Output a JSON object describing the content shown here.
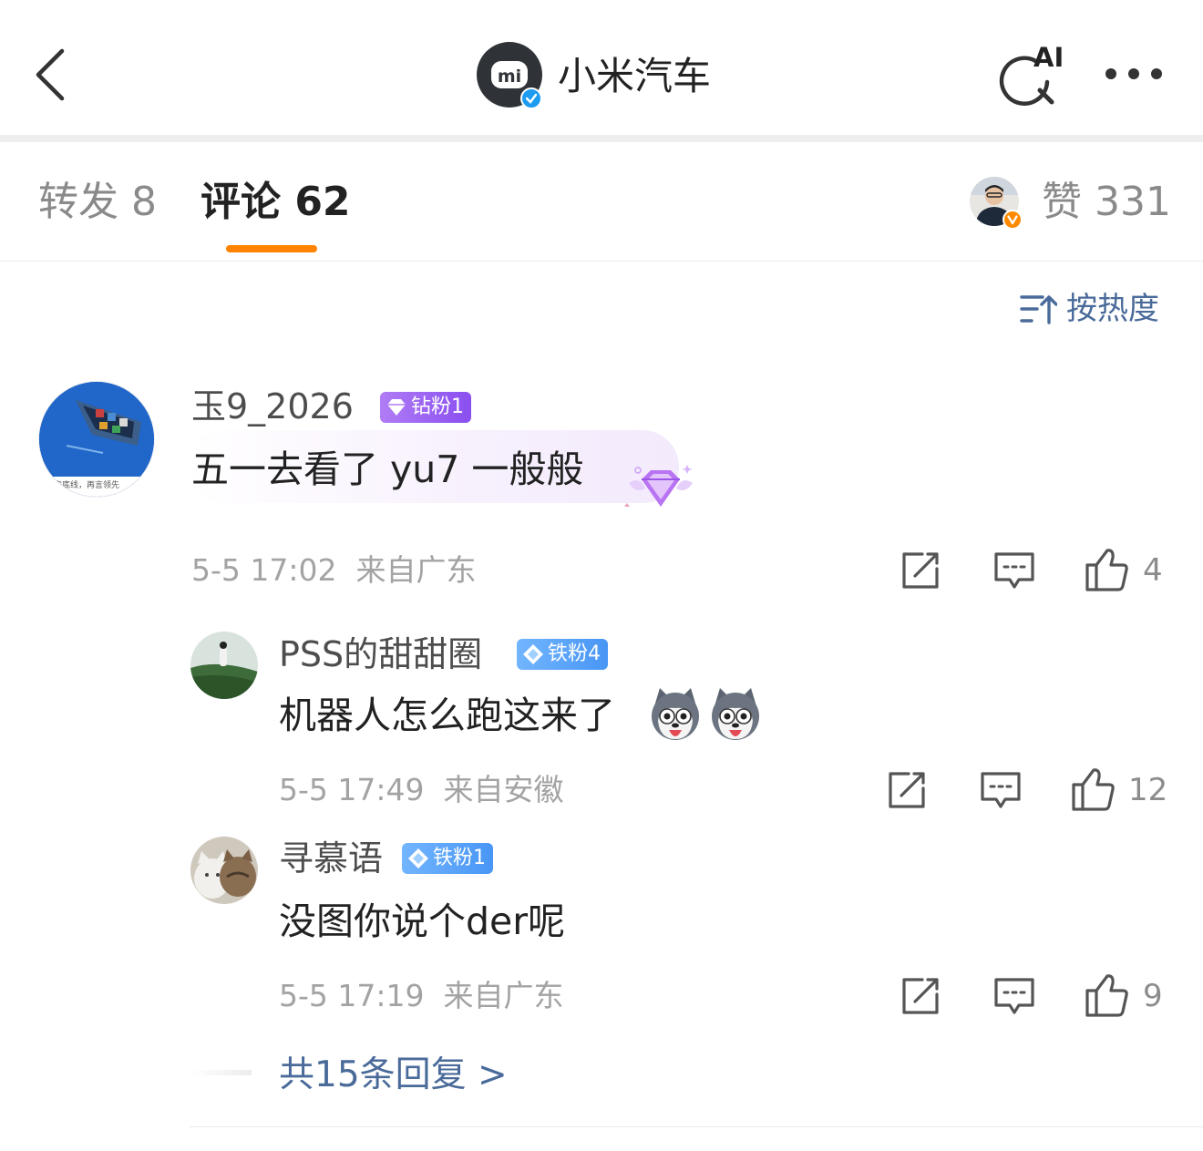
{
  "header": {
    "title": "小米汽车",
    "logo_text": "mi",
    "ai_label": "AI",
    "icons": [
      "back-arrow-icon",
      "verified-badge-icon",
      "ai-search-icon",
      "more-icon"
    ]
  },
  "tabs": [
    {
      "label": "转发 8",
      "active": false
    },
    {
      "label": "评论 62",
      "active": true
    },
    {
      "label": "赞 331",
      "active": false
    }
  ],
  "sort": {
    "label": "按热度",
    "icon": "sort-icon"
  },
  "comments": [
    {
      "user": "玉9_2026",
      "badge": "钻粉1",
      "text": "五一去看了 yu7 一般般",
      "avatar_caption": "守底线，再言领先",
      "time": "5-5 17:02",
      "location": "来自广东",
      "likes": "4",
      "decoration_icon": "diamond-fan-sticker-icon"
    }
  ],
  "replies": [
    {
      "user": "PSS的甜甜圈",
      "badge": "铁粉4",
      "text": "机器人怎么跑这来了",
      "emoji_icons": [
        "husky-emoji-icon",
        "husky-emoji-icon"
      ],
      "time": "5-5 17:49",
      "location": "来自安徽",
      "likes": "12"
    },
    {
      "user": "寻慕语",
      "badge": "铁粉1",
      "text": "没图你说个der呢",
      "time": "5-5 17:19",
      "location": "来自广东",
      "likes": "9"
    }
  ],
  "more_replies": "共15条回复 >",
  "colors": {
    "accent_orange": "#ff8200",
    "link_blue": "#4a6b9a",
    "badge_purple": "#8a4ff0",
    "badge_blue": "#4896f5",
    "verified_blue": "#1d9bf0"
  }
}
